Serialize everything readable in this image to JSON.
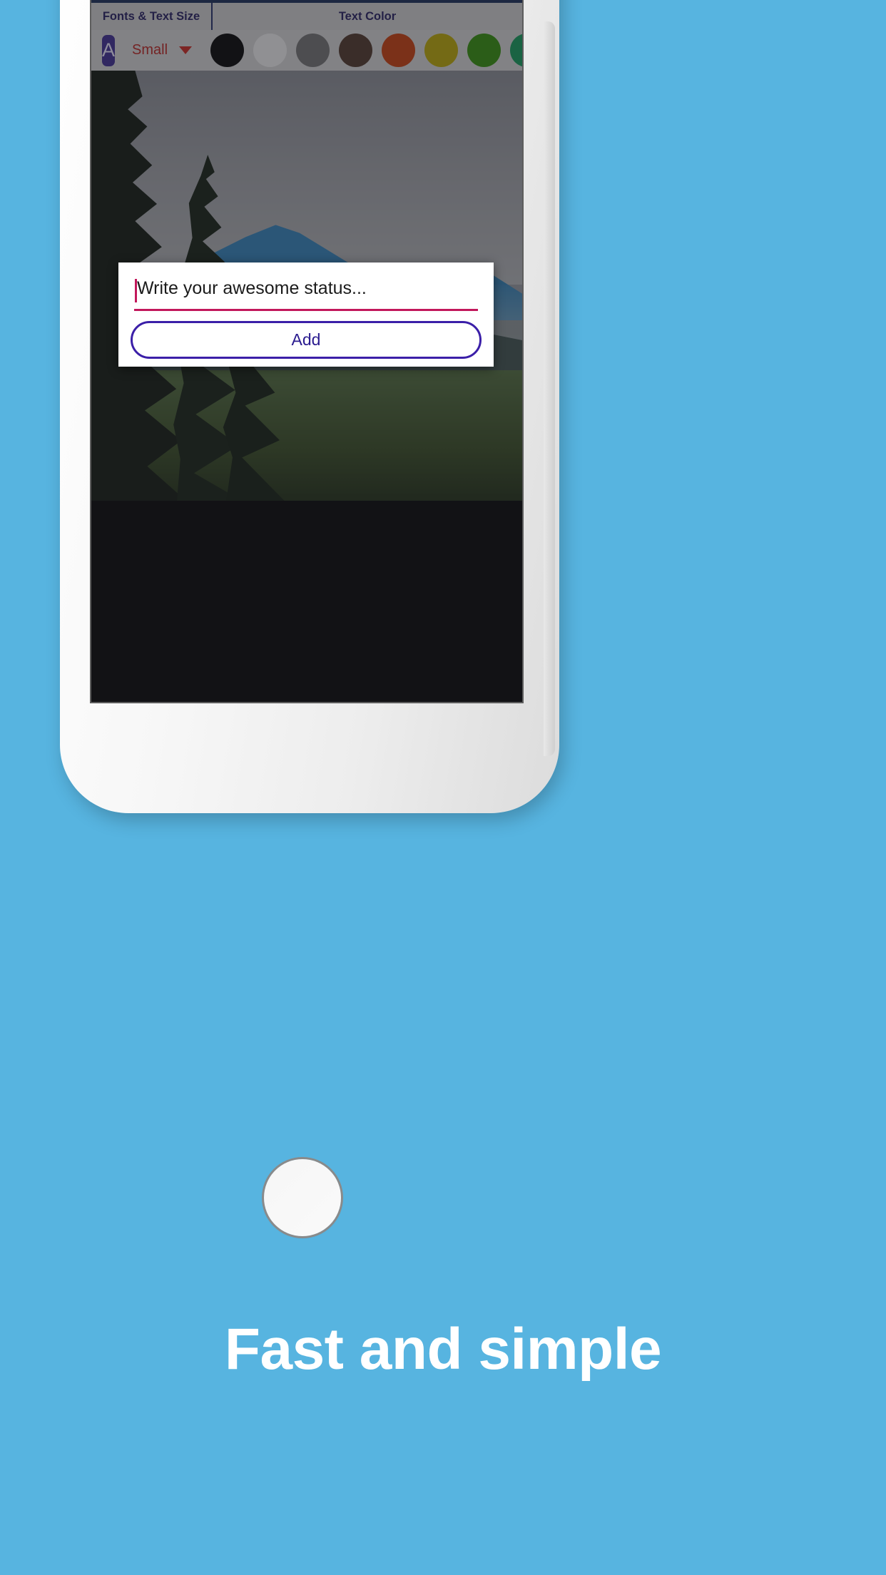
{
  "page": {
    "background_color": "#57b4e0",
    "caption": "Fast and simple"
  },
  "phone": {
    "home_button_name": "home-button"
  },
  "app": {
    "toolbar": {
      "fonts_title": "Fonts & Text Size",
      "color_title": "Text Color",
      "font_icon_label": "A",
      "size_value": "Small",
      "caret_icon": "chevron-down-icon",
      "swatches": [
        {
          "name": "black",
          "hex": "#000000"
        },
        {
          "name": "white",
          "hex": "#e9e9e9"
        },
        {
          "name": "gray",
          "hex": "#6e6e6e"
        },
        {
          "name": "dark-brown",
          "hex": "#4a3226"
        },
        {
          "name": "red-orange",
          "hex": "#c23a08"
        },
        {
          "name": "olive-yellow",
          "hex": "#b5a300"
        },
        {
          "name": "green",
          "hex": "#2f8b06"
        },
        {
          "name": "teal-green",
          "hex": "#0f9656"
        }
      ]
    },
    "dialog": {
      "input_placeholder": "Write your awesome status...",
      "input_value": "",
      "underline_color": "#c2185b",
      "add_label": "Add",
      "add_border_color": "#3b1fa8"
    }
  }
}
